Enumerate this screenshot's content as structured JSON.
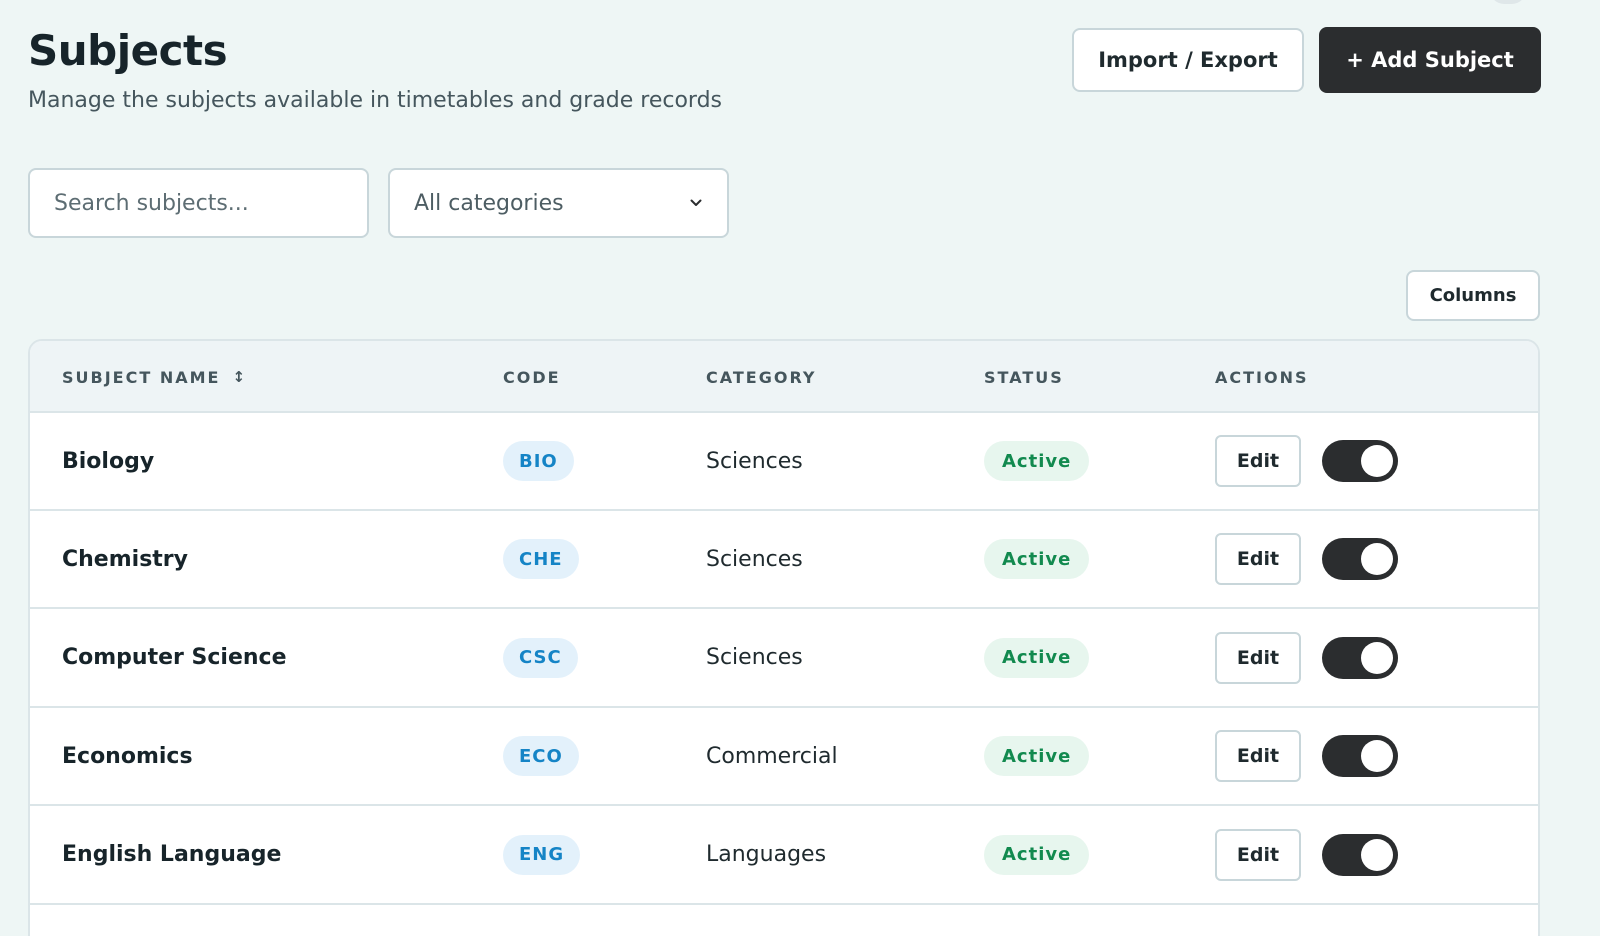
{
  "header": {
    "title": "Subjects",
    "subtitle": "Manage the subjects available in timetables and grade records",
    "import_export_label": "Import / Export",
    "add_subject_label": "+ Add Subject"
  },
  "filters": {
    "search_placeholder": "Search subjects...",
    "category_selected": "All categories"
  },
  "toolbar": {
    "columns_label": "Columns"
  },
  "table": {
    "columns": {
      "subject_name": "SUBJECT NAME",
      "code": "CODE",
      "category": "CATEGORY",
      "status": "STATUS",
      "actions": "ACTIONS"
    },
    "sort_icon": "↕",
    "edit_label": "Edit",
    "rows": [
      {
        "name": "Biology",
        "code": "BIO",
        "category": "Sciences",
        "status": "Active",
        "enabled": true
      },
      {
        "name": "Chemistry",
        "code": "CHE",
        "category": "Sciences",
        "status": "Active",
        "enabled": true
      },
      {
        "name": "Computer Science",
        "code": "CSC",
        "category": "Sciences",
        "status": "Active",
        "enabled": true
      },
      {
        "name": "Economics",
        "code": "ECO",
        "category": "Commercial",
        "status": "Active",
        "enabled": true
      },
      {
        "name": "English Language",
        "code": "ENG",
        "category": "Languages",
        "status": "Active",
        "enabled": true
      }
    ]
  },
  "colors": {
    "background": "#eef6f5",
    "primary_button": "#2b2d2f",
    "code_badge_text": "#1584c6",
    "status_active_text": "#128a4f"
  },
  "icons": {
    "category_dropdown": "chevron-down-icon",
    "sort": "sort-icon"
  }
}
